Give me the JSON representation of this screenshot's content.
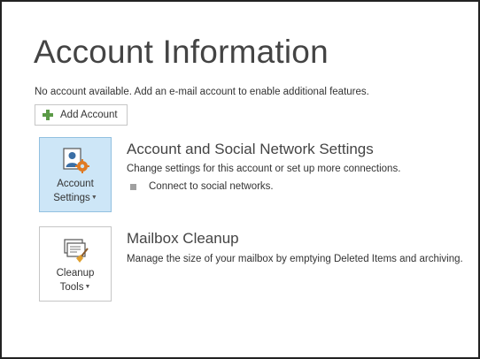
{
  "page": {
    "title": "Account Information",
    "notice": "No account available. Add an e-mail account to enable additional features."
  },
  "add_account": {
    "label": "Add Account",
    "icon": "plus-icon",
    "icon_color": "#5b9a47"
  },
  "account_settings": {
    "tile_label_line1": "Account",
    "tile_label_line2": "Settings",
    "icon": "account-settings-icon",
    "selected": true,
    "selected_color": "#cde6f7",
    "title": "Account and Social Network Settings",
    "description": "Change settings for this account or set up more connections.",
    "bullets": [
      "Connect to social networks."
    ]
  },
  "mailbox_cleanup": {
    "tile_label_line1": "Cleanup",
    "tile_label_line2": "Tools",
    "icon": "cleanup-tools-icon",
    "title": "Mailbox Cleanup",
    "description": "Manage the size of your mailbox by emptying Deleted Items and archiving."
  }
}
